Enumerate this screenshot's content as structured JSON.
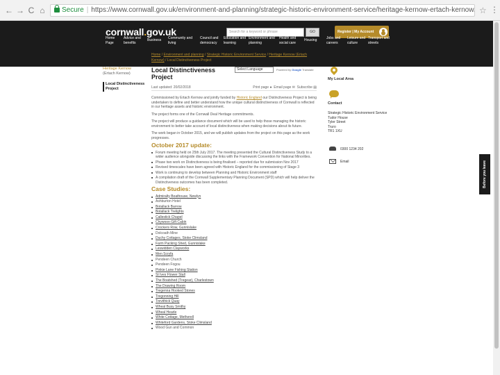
{
  "browser": {
    "secure_label": "Secure",
    "url": "https://www.cornwall.gov.uk/environment-and-planning/strategic-historic-environment-service/heritage-kernow-ertach-kernow/local-distinctiveness-project/",
    "back": "←",
    "forward": "→",
    "reload": "C",
    "home": "⌂",
    "star": "☆",
    "menu": "⋮"
  },
  "header": {
    "logo_main": "cornwall",
    "logo_dot": ".",
    "logo_tail": "gov.uk",
    "search_placeholder": "Search for a keyword or phrase",
    "search_go": "GO",
    "register": "Register | My Account"
  },
  "nav": [
    {
      "l1": "Home",
      "l2": "Page"
    },
    {
      "l1": "Advice and",
      "l2": "benefits"
    },
    {
      "l1": "Business",
      "l2": ""
    },
    {
      "l1": "Community and",
      "l2": "living"
    },
    {
      "l1": "Council and",
      "l2": "democracy"
    },
    {
      "l1": "Education and",
      "l2": "learning"
    },
    {
      "l1": "Environment and",
      "l2": "planning"
    },
    {
      "l1": "Health and",
      "l2": "social care"
    },
    {
      "l1": "Housing",
      "l2": ""
    },
    {
      "l1": "Jobs and",
      "l2": "careers"
    },
    {
      "l1": "Leisure and",
      "l2": "culture"
    },
    {
      "l1": "Transport and",
      "l2": "streets"
    }
  ],
  "breadcrumb": {
    "items": [
      "Home",
      "Environment and planning",
      "Strategic Historic Environment Service",
      "Heritage Kernow (Ertach Kernow)",
      "Local Distinctiveness Project"
    ]
  },
  "leftnav": {
    "parent": "Heritage Kernow",
    "parent_sub": "(Ertach Kernow)",
    "current": "Local Distinctiveness Project"
  },
  "main": {
    "title_line1": "Local Distinctiveness",
    "title_line2": "Project",
    "language": "Select Language",
    "powered_prefix": "Powered by",
    "powered_brand": "Google",
    "powered_suffix": "Translate",
    "last_updated": "Last updated: 20/02/2018",
    "print": "Print page",
    "email": "Email page",
    "subscribe": "Subscribe",
    "para1_a": "Commissioned by Ertach Kernow and jointly funded by ",
    "para1_link": "Historic England",
    "para1_b": " our Distinctiveness Project is being undertaken to define and better understand how the unique cultural distinctiveness of Cornwall is reflected in our heritage assets and historic environment.",
    "para2": "The project forms one of the Cornwall Deal Heritage commitments.",
    "para3": "The project will produce a guidance document which will be used to help those managing the historic environment to better take account of local distinctiveness when making decisions about its future.",
    "para4": "The work began in October 2015, and we will publish updates from the project on this page as the work progresses.",
    "update_heading": "October 2017 update:",
    "updates": [
      "Forum meeting held on 25th July 2017. The meeting presented the Cultural Distinctiveness Study to a wider audience alongside discussing the links with the Framework Convention for National Minorities.",
      "Phase two work on Distinctiveness is being finalised – reported due for submission Nov 2017",
      "Revised timescales have been agreed with Historic England for the commissioning of Stage 3",
      "Work is continuing to develop between Planning and Historic Environment staff",
      "A compilation draft of the Cornwall Supplementary Planning Document (SPD) which will help deliver the Distinctiveness outcomes has been completed."
    ],
    "case_heading": "Case Studies:",
    "cases": [
      "Admiralty Boathouse, Newlyn",
      "Ashburton Hotel",
      "Botallack Barrow",
      "Botallack Trelights",
      "Callestick Chapel",
      "Chywoon Gift Cabin",
      "Crockers Row, Gunnislake",
      "Dolcoath Mine",
      "Duchy Cottages, Stoke Climsland",
      "Farm Packing Shed, Gunnislake",
      "Leswidden Clayworks",
      "Men Scryfa",
      "Pendeen Church",
      "Pendeen Fogou",
      "Pinkie Lane Fishing Station",
      "St Ives Flower Stall",
      "The Boatshed (Tregear), Charlestown",
      "The Drawing Room",
      "Tregenna Hooked Stones",
      "Tregonning Hill",
      "Trevithick Quay",
      "Wheal Busy Smithy",
      "Wheal Hearle",
      "White Cottage, Metherell",
      "Whiteford Gardens, Stoke Climsland",
      "Wood Gun and Common"
    ],
    "case_links": [
      true,
      false,
      true,
      true,
      true,
      true,
      true,
      false,
      true,
      true,
      true,
      true,
      false,
      false,
      true,
      true,
      true,
      true,
      true,
      true,
      true,
      true,
      true,
      true,
      true,
      false
    ]
  },
  "right": {
    "local_area": "My Local Area",
    "contact": "Contact",
    "contact_name": "Strategic Historic Environment Service",
    "address": [
      "Tudor House",
      "Tyler Street",
      "Truro",
      "TR1 1XU"
    ],
    "phone": "0300 1234 202",
    "email": "Email"
  },
  "feedback": "Before you leave"
}
